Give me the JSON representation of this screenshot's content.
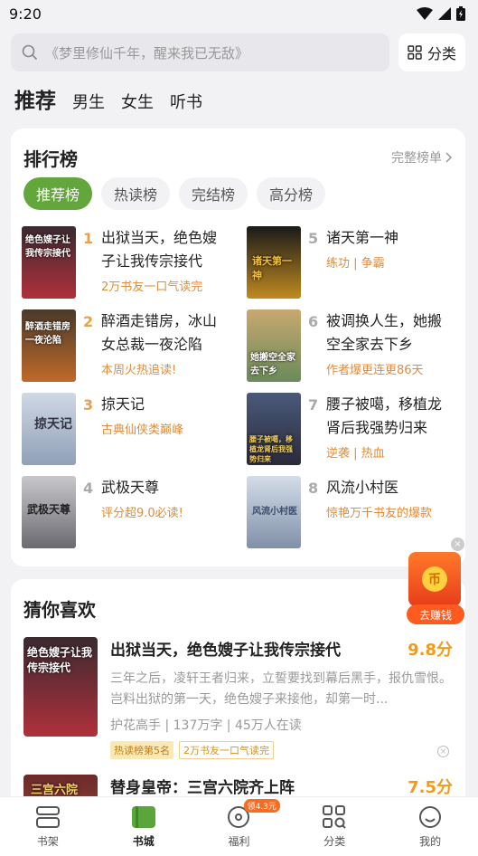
{
  "status": {
    "time": "9:20"
  },
  "search": {
    "placeholder": "《梦里修仙千年，醒来我已无敌》",
    "category_label": "分类"
  },
  "top_tabs": [
    {
      "label": "推荐",
      "active": true
    },
    {
      "label": "男生"
    },
    {
      "label": "女生"
    },
    {
      "label": "听书"
    }
  ],
  "ranking": {
    "title": "排行榜",
    "full_list": "完整榜单",
    "pills": [
      {
        "label": "推荐榜",
        "active": true
      },
      {
        "label": "热读榜"
      },
      {
        "label": "完结榜"
      },
      {
        "label": "高分榜"
      }
    ],
    "items": [
      {
        "rank": "1",
        "title": "出狱当天，绝色嫂子让我传宗接代",
        "tag": "2万书友一口气读完"
      },
      {
        "rank": "2",
        "title": "醉酒走错房，冰山女总裁一夜沦陷",
        "tag": "本周火热追读!"
      },
      {
        "rank": "3",
        "title": "掠天记",
        "tag": "古典仙侠类巅峰"
      },
      {
        "rank": "4",
        "title": "武极天尊",
        "tag": "评分超9.0必读!"
      },
      {
        "rank": "5",
        "title": "诸天第一神",
        "tag": "练功 | 争霸"
      },
      {
        "rank": "6",
        "title": "被调换人生，她搬空全家去下乡",
        "tag": "作者爆更连更86天"
      },
      {
        "rank": "7",
        "title": "腰子被噶，移植龙肾后我强势归来",
        "tag": "逆袭 | 热血"
      },
      {
        "rank": "8",
        "title": "风流小村医",
        "tag": "惊艳万千书友的爆款"
      }
    ],
    "covers": [
      {
        "text": "绝色嫂子让我传宗接代",
        "colors": [
          "#3a2a30",
          "#b0303a"
        ]
      },
      {
        "text": "醉酒走错房一夜沦陷",
        "colors": [
          "#4a3a2a",
          "#c06a2a"
        ]
      },
      {
        "text": "掠天记",
        "colors": [
          "#d0d8e4",
          "#8fa0b8"
        ]
      },
      {
        "text": "武极天尊",
        "colors": [
          "#c8c8cc",
          "#6a6a70"
        ]
      },
      {
        "text": "诸天第一神",
        "colors": [
          "#1a1a1a",
          "#c08a20"
        ]
      },
      {
        "text": "她搬空全家去下乡",
        "colors": [
          "#c8a870",
          "#6a8a5a"
        ]
      },
      {
        "text": "腰子被噶，移植龙肾后我强势归来",
        "colors": [
          "#4a5a7a",
          "#2a2a3a"
        ]
      },
      {
        "text": "风流小村医",
        "colors": [
          "#d4dde8",
          "#8090a8"
        ]
      }
    ]
  },
  "guess": {
    "title": "猜你喜欢",
    "books": [
      {
        "title": "出狱当天，绝色嫂子让我传宗接代",
        "score": "9.8分",
        "desc": "三年之后，凌轩王者归来，立誓要找到幕后黑手，报仇雪恨。岂料出狱的第一天，绝色嫂子来接他，却第一时...",
        "author": "护花高手",
        "words": "137万字",
        "readers": "45万人在读",
        "tag1": "热读榜第5名",
        "tag2": "2万书友一口气读完",
        "cover_text": "绝色嫂子让我传宗接代"
      },
      {
        "title": "替身皇帝：三宫六院齐上阵",
        "score": "7.5分",
        "cover_text": "三宫六院"
      }
    ]
  },
  "earn": {
    "label": "去赚钱",
    "coin": "币"
  },
  "tabbar": {
    "items": [
      {
        "label": "书架"
      },
      {
        "label": "书城",
        "active": true
      },
      {
        "label": "福利",
        "badge": "领4.3元"
      },
      {
        "label": "分类"
      },
      {
        "label": "我的"
      }
    ]
  }
}
